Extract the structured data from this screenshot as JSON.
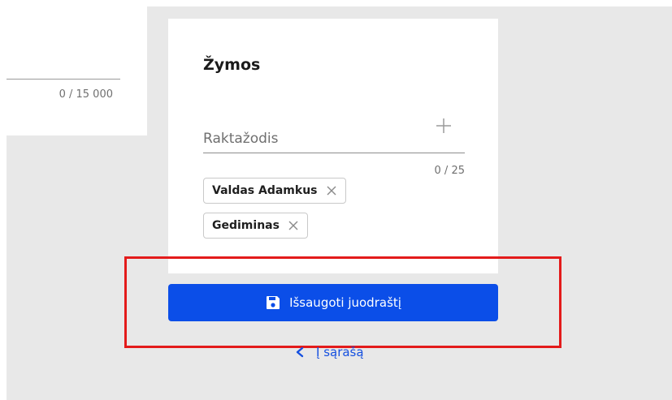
{
  "left_card": {
    "counter": "0 / 15 000"
  },
  "tags": {
    "title": "Žymos",
    "input_placeholder": "Raktažodis",
    "input_value": "",
    "counter": "0 / 25",
    "add_icon": "plus-icon",
    "chips": [
      {
        "label": "Valdas Adamkus",
        "remove_icon": "close-icon"
      },
      {
        "label": "Gediminas",
        "remove_icon": "close-icon"
      }
    ]
  },
  "save_button": {
    "label": "Išsaugoti juodraštį",
    "icon": "floppy-disk-icon"
  },
  "back_link": {
    "label": "Į sąrašą",
    "icon": "chevron-left-icon"
  },
  "colors": {
    "accent": "#0b4ee8",
    "highlight": "#e31b1b",
    "background": "#e8e8e8"
  }
}
